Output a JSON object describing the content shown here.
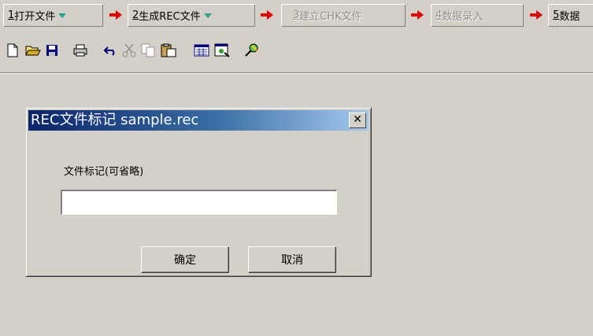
{
  "steps": [
    {
      "num": "1",
      "label": "打开文件",
      "dropdown": true,
      "enabled": true
    },
    {
      "num": "2",
      "label": "生成REC文件",
      "dropdown": true,
      "enabled": true
    },
    {
      "num": "3",
      "label": "建立CHK文件",
      "dropdown": false,
      "enabled": false
    },
    {
      "num": "4",
      "label": "数据录入",
      "dropdown": false,
      "enabled": false
    },
    {
      "num": "5",
      "label": "数据",
      "dropdown": false,
      "enabled": true
    }
  ],
  "toolbar": {
    "icons": [
      "new-file-icon",
      "open-folder-icon",
      "save-disk-icon",
      "print-icon",
      "undo-icon",
      "cut-icon",
      "copy-icon",
      "paste-icon",
      "calculator-icon",
      "window-icon",
      "dropper-icon"
    ]
  },
  "dialog": {
    "title": "REC文件标记 sample.rec",
    "close_glyph": "✕",
    "field_label": "文件标记(可省略)",
    "input_value": "",
    "ok_label": "确定",
    "cancel_label": "取消"
  },
  "colors": {
    "title_gradient_start": "#0a246a",
    "title_gradient_end": "#a6caf0",
    "arrow_red": "#e00000",
    "dropdown_teal": "#2aa58a",
    "face": "#d4d0c8"
  }
}
